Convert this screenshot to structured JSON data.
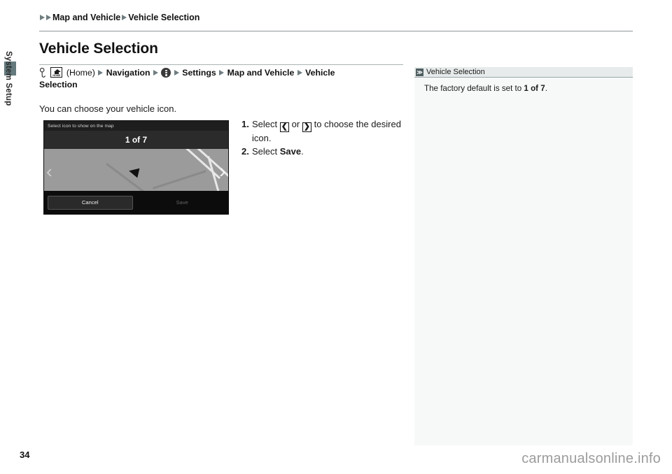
{
  "sidebar": {
    "section_label": "System Setup"
  },
  "breadcrumb": {
    "items": [
      "Map and Vehicle",
      "Vehicle Selection"
    ]
  },
  "page": {
    "title": "Vehicle Selection",
    "number": "34"
  },
  "navpath": {
    "key_icon": "key-icon",
    "home_icon_label": "HOME",
    "home_label": "(Home)",
    "step1": "Navigation",
    "menu_icon": "three-dots-circle-icon",
    "step2": "Settings",
    "step3": "Map and Vehicle",
    "step4": "Vehicle",
    "step4_wrap": "Selection"
  },
  "intro": {
    "text": "You can choose your vehicle icon."
  },
  "screen": {
    "title": "Select icon to show on the map",
    "counter": "1 of 7",
    "cancel_label": "Cancel",
    "save_label": "Save",
    "prev_chevron": "‹",
    "next_chevron": "›"
  },
  "steps": [
    {
      "num": "1.",
      "pre": "Select",
      "key_left": "❮",
      "mid": "or",
      "key_right": "❯",
      "post": "to choose the desired icon."
    },
    {
      "num": "2.",
      "pre": "Select",
      "bold": "Save",
      "post": "."
    }
  ],
  "right_panel": {
    "header": "Vehicle Selection",
    "marker": "≫",
    "body_pre": "The factory default is set to ",
    "body_bold": "1 of 7",
    "body_post": "."
  },
  "footer": {
    "watermark": "carmanualsonline.info"
  },
  "colors": {
    "tab": "#647a7d",
    "panel_bg": "#f7f9f9",
    "panel_head_bg": "#e7ebeb",
    "arrow": "#6f7d80"
  }
}
